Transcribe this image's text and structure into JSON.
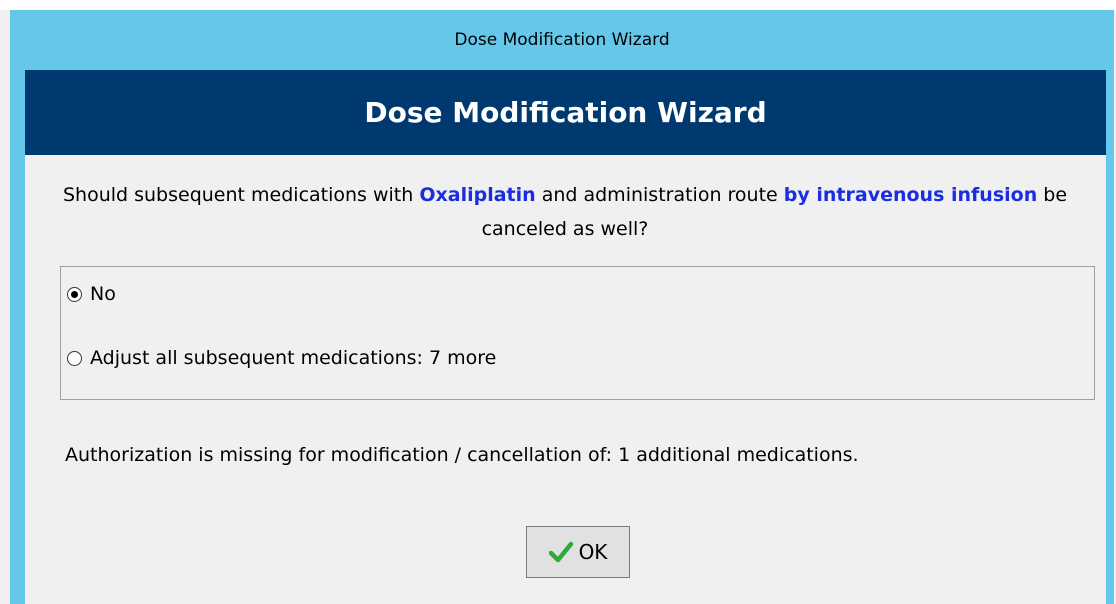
{
  "window": {
    "title": "Dose Modification Wizard"
  },
  "header": {
    "title": "Dose Modification Wizard"
  },
  "question": {
    "part1": "Should subsequent medications with ",
    "drug": "Oxaliplatin",
    "part2": " and administration route ",
    "route": "by intravenous infusion",
    "part3": " be canceled as well?"
  },
  "options": [
    {
      "label": "No",
      "selected": true
    },
    {
      "label": "Adjust all subsequent medications: 7 more",
      "selected": false
    }
  ],
  "auth_message": "Authorization is missing for modification / cancellation of: 1 additional medications.",
  "ok_button": {
    "label": "OK",
    "icon": "checkmark-icon"
  },
  "colors": {
    "titlebar": "#65c8ea",
    "header_band": "#003870",
    "highlight": "#1a2ee0"
  }
}
